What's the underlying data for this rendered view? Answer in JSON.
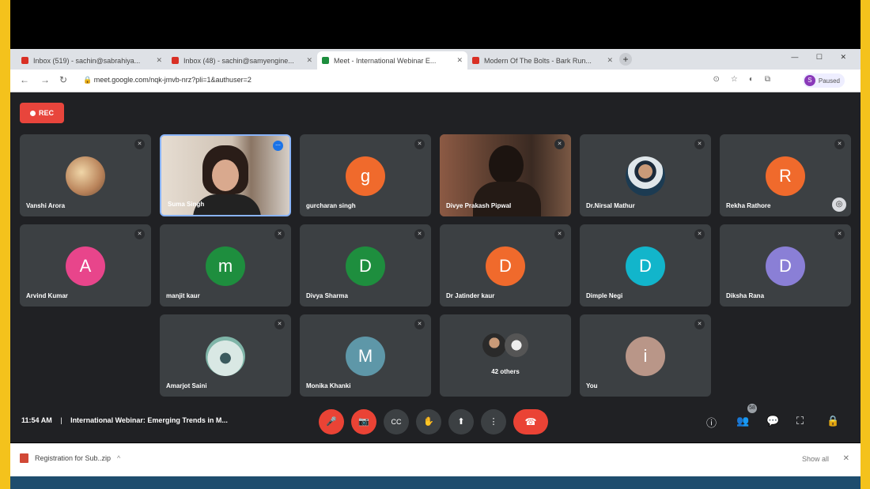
{
  "browser": {
    "tabs": [
      {
        "title": "Inbox (519) - sachin@sabrahiya...",
        "color": "#d93025"
      },
      {
        "title": "Inbox (48) - sachin@samyengine...",
        "color": "#d93025"
      },
      {
        "title": "Meet - International Webinar E...",
        "color": "#1e8e3e",
        "active": true
      },
      {
        "title": "Modern Of The Bolts - Bark Run...",
        "color": "#d93025"
      }
    ],
    "url": "meet.google.com/nqk-jmvb-nrz?pli=1&authuser=2",
    "profile_label": "Paused",
    "profile_initial": "S",
    "new_tab": "+",
    "window_controls": "— ☐ ✕"
  },
  "recording_label": "REC",
  "participants": [
    {
      "name": "Vanshi Arora",
      "type": "photo"
    },
    {
      "name": "Suma Singh",
      "type": "video"
    },
    {
      "name": "gurcharan singh",
      "type": "avatar",
      "initial": "g",
      "color": "#f06a2c"
    },
    {
      "name": "Divye Prakash Pipwal",
      "type": "video"
    },
    {
      "name": "Dr.Nirsal Mathur",
      "type": "photo"
    },
    {
      "name": "Rekha Rathore",
      "type": "avatar",
      "initial": "R",
      "color": "#f06a2c"
    },
    {
      "name": "Arvind Kumar",
      "type": "avatar",
      "initial": "A",
      "color": "#e8458b"
    },
    {
      "name": "manjit kaur",
      "type": "avatar",
      "initial": "m",
      "color": "#1e8e3e"
    },
    {
      "name": "Divya Sharma",
      "type": "avatar",
      "initial": "D",
      "color": "#1e8e3e"
    },
    {
      "name": "Dr Jatinder kaur",
      "type": "avatar",
      "initial": "D",
      "color": "#f06a2c"
    },
    {
      "name": "Dimple Negi",
      "type": "avatar",
      "initial": "D",
      "color": "#12b5cb"
    },
    {
      "name": "Diksha Rana",
      "type": "avatar",
      "initial": "D",
      "color": "#8a7fd6"
    },
    {
      "name": "Amarjot Saini",
      "type": "photo"
    },
    {
      "name": "Monika Khanki",
      "type": "avatar",
      "initial": "M",
      "color": "#5e97a8"
    },
    {
      "name": "42 others",
      "type": "group"
    },
    {
      "name": "You",
      "type": "avatar",
      "initial": "i",
      "color": "#b99688"
    }
  ],
  "meeting": {
    "time": "11:54 AM",
    "title": "International Webinar: Emerging Trends in M..."
  },
  "controls": {
    "mic": "🎤",
    "camera": "📷",
    "captions": "CC",
    "raise_hand": "✋",
    "present": "⬆",
    "more": "⋮",
    "end_call": "☎"
  },
  "right_controls": {
    "info": "ⓘ",
    "people": "👥",
    "people_count": "58",
    "chat": "💬",
    "activities": "⛶",
    "host": "🔒"
  },
  "download": {
    "file": "Registration for Sub..zip",
    "show_all": "Show all",
    "close": "✕"
  }
}
